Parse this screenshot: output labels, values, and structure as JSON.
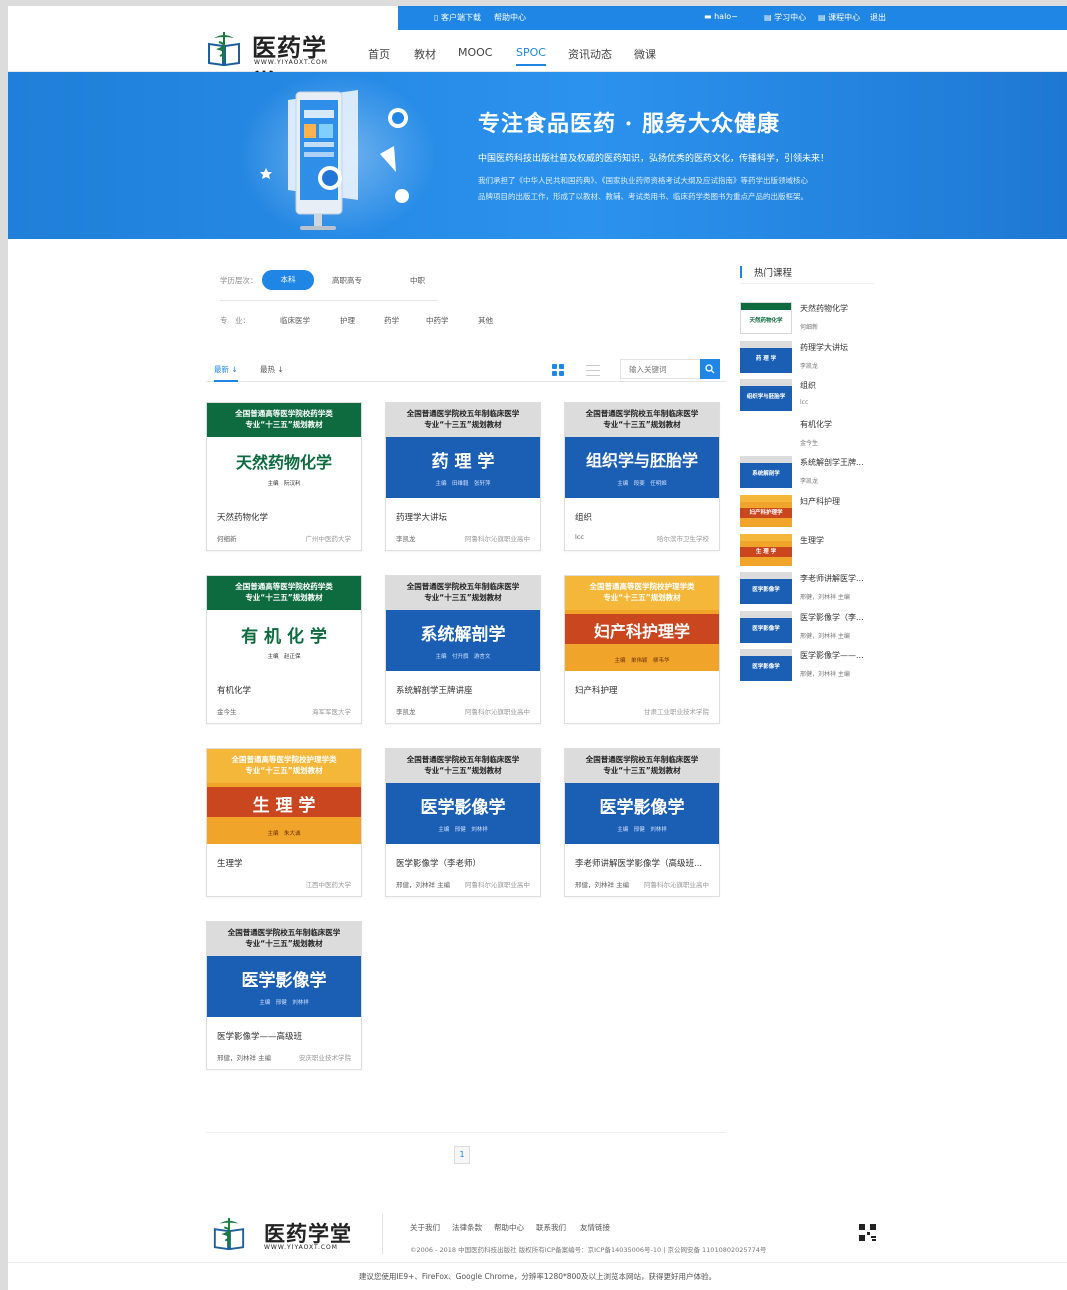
{
  "topbar": {
    "links": [
      "客户端下载",
      "帮助中心"
    ],
    "user": "halo~",
    "right_links": [
      "学习中心",
      "课程中心",
      "退出"
    ]
  },
  "logo": {
    "name": "医药学堂",
    "url": "WWW.YIYAOXT.COM"
  },
  "nav": [
    "首页",
    "教材",
    "MOOC",
    "SPOC",
    "资讯动态",
    "微课"
  ],
  "nav_active": "SPOC",
  "banner": {
    "title": "专注食品医药 · 服务大众健康",
    "line1": "中国医药科技出版社普及权威的医药知识，弘扬优秀的医药文化，传播科学，引领未来！",
    "line2": "我们承担了《中华人民共和国药典》、《国家执业药师资格考试大纲及应试指南》等药学出版领域核心",
    "line3": "品牌项目的出版工作，形成了以教材、教辅、考试类用书、临床药学类图书为重点产品的出版框架。"
  },
  "filters": {
    "level_label": "学历层次：",
    "levels": [
      "本科",
      "高职高专",
      "中职"
    ],
    "major_label": "专　业：",
    "majors": [
      "临床医学",
      "护理",
      "药学",
      "中药学",
      "其他"
    ]
  },
  "sort": {
    "latest": "最新 ↓",
    "hottest": "最热 ↓",
    "search_placeholder": "输入关键词"
  },
  "courses": [
    {
      "theme": "green",
      "band": "全国普通高等医学院校药学类\n专业“十三五”规划教材",
      "cover_title": "天然药物化学",
      "cover_editor": "主编　阮汉利",
      "name": "天然药物化学",
      "author": "何细新",
      "school": "广州中医药大学"
    },
    {
      "theme": "blue",
      "band": "全国普通医学院校五年制临床医学\n专业“十三五”规划教材",
      "cover_title": "药 理 学",
      "cover_editor": "主编　田维毅　张轩萍",
      "name": "药理学大讲坛",
      "author": "李凯龙",
      "school": "阿鲁科尔沁旗职业高中"
    },
    {
      "theme": "blue",
      "band": "全国普通医学院校五年制临床医学\n专业“十三五”规划教材",
      "cover_title": "组织学与胚胎学",
      "cover_editor": "主编　段斐　任明姬",
      "name": "组织",
      "author": "lcc",
      "school": "哈尔滨市卫生学校"
    },
    {
      "theme": "green",
      "band": "全国普通高等医学院校药学类\n专业“十三五”规划教材",
      "cover_title": "有 机 化 学",
      "cover_editor": "主编　赵正保",
      "name": "有机化学",
      "author": "金今生",
      "school": "海军军医大学"
    },
    {
      "theme": "blue",
      "band": "全国普通医学院校五年制临床医学\n专业“十三五”规划教材",
      "cover_title": "系统解剖学",
      "cover_editor": "主编　付升旗　游言文",
      "name": "系统解剖学王牌讲座",
      "author": "李凯龙",
      "school": "阿鲁科尔沁旗职业高中"
    },
    {
      "theme": "orange",
      "band": "全国普通高等医学院校护理学类\n专业“十三五”规划教材",
      "cover_title": "妇产科护理学",
      "cover_editor": "主编　单伟颖　柳韦华",
      "name": "妇产科护理",
      "author": "",
      "school": "甘肃工业职业技术学院"
    },
    {
      "theme": "orange",
      "band": "全国普通高等医学院校护理学类\n专业“十三五”规划教材",
      "cover_title": "生 理 学",
      "cover_editor": "主编　朱大诚",
      "name": "生理学",
      "author": "",
      "school": "江西中医药大学"
    },
    {
      "theme": "blue",
      "band": "全国普通医学院校五年制临床医学\n专业“十三五”规划教材",
      "cover_title": "医学影像学",
      "cover_editor": "主编　邢健　刘林祥",
      "name": "医学影像学（李老师）",
      "author": "邢健，刘林祥 主编",
      "school": "阿鲁科尔沁旗职业高中"
    },
    {
      "theme": "blue",
      "band": "全国普通医学院校五年制临床医学\n专业“十三五”规划教材",
      "cover_title": "医学影像学",
      "cover_editor": "主编　邢健　刘林祥",
      "name": "李老师讲解医学影像学（高级班...",
      "author": "邢健，刘林祥 主编",
      "school": "阿鲁科尔沁旗职业高中"
    },
    {
      "theme": "blue",
      "band": "全国普通医学院校五年制临床医学\n专业“十三五”规划教材",
      "cover_title": "医学影像学",
      "cover_editor": "主编　邢健　刘林祥",
      "name": "医学影像学——高级班",
      "author": "邢健，刘林祥 主编",
      "school": "安庆职业技术学院"
    }
  ],
  "page": "1",
  "hot": {
    "title": "热门课程",
    "items": [
      {
        "theme": "green",
        "thumb": "天然药物化学",
        "name": "天然药物化学",
        "author": "何细新"
      },
      {
        "theme": "blue",
        "thumb": "药 理 学",
        "name": "药理学大讲坛",
        "author": "李凯龙"
      },
      {
        "theme": "blue",
        "thumb": "组织学与胚胎学",
        "name": "组织",
        "author": "lcc"
      },
      {
        "theme": "none",
        "thumb": "",
        "name": "有机化学",
        "author": "金今生"
      },
      {
        "theme": "blue",
        "thumb": "系统解剖学",
        "name": "系统解剖学王牌...",
        "author": "李凯龙"
      },
      {
        "theme": "orange",
        "thumb": "妇产科护理学",
        "name": "妇产科护理",
        "author": ""
      },
      {
        "theme": "orange",
        "thumb": "生 理 学",
        "name": "生理学",
        "author": ""
      },
      {
        "theme": "blue",
        "thumb": "医学影像学",
        "name": "李老师讲解医学...",
        "author": "邢健，刘林祥 主编"
      },
      {
        "theme": "blue",
        "thumb": "医学影像学",
        "name": "医学影像学（李...",
        "author": "邢健，刘林祥 主编"
      },
      {
        "theme": "blue",
        "thumb": "医学影像学",
        "name": "医学影像学——...",
        "author": "邢健，刘林祥 主编"
      }
    ]
  },
  "footer": {
    "links": [
      "关于我们",
      "法律条款",
      "帮助中心",
      "联系我们",
      "友情链接"
    ],
    "copyright": "©2006 - 2018 中国医药科技出版社 版权所有ICP备案编号：京ICP备14035006号-10 | 京公网安备 11010802025774号",
    "browser_note": "建议您使用IE9+、FireFox、Google Chrome，分辨率1280*800及以上浏览本网站，获得更好用户体验。"
  }
}
